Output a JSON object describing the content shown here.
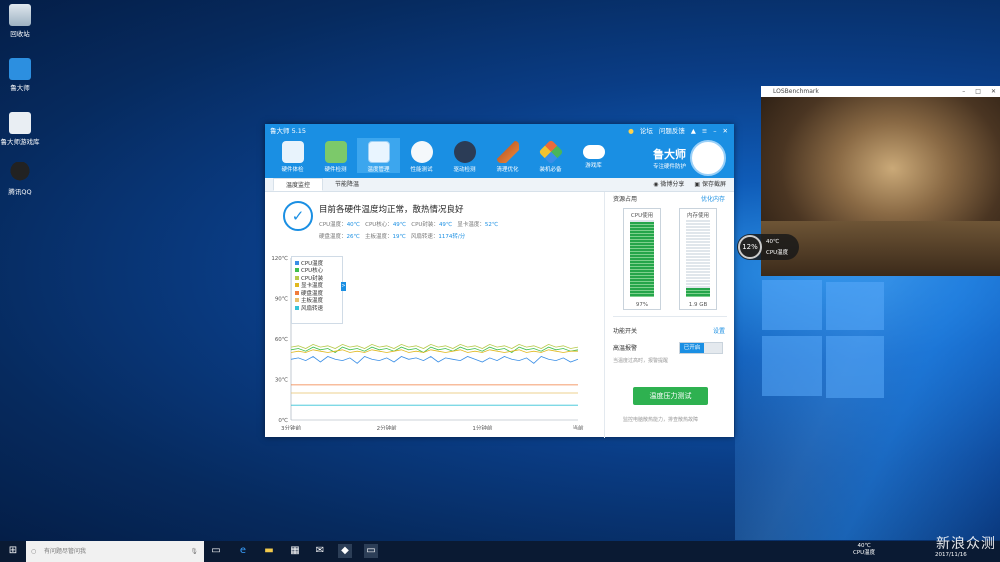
{
  "desktop_icons": [
    {
      "label": "回收站"
    },
    {
      "label": "鲁大师"
    },
    {
      "label": "鲁大师游戏库"
    },
    {
      "label": "腾讯QQ"
    }
  ],
  "app": {
    "title": "鲁大师 5.15",
    "title_links": [
      "论坛",
      "问题反馈"
    ],
    "toolbar": [
      {
        "label": "硬件体检",
        "icon": "monitor-check-icon"
      },
      {
        "label": "硬件检测",
        "icon": "chip-icon"
      },
      {
        "label": "温度管理",
        "icon": "thermometer-icon"
      },
      {
        "label": "性能测试",
        "icon": "speedometer-icon"
      },
      {
        "label": "驱动检测",
        "icon": "driver-icon"
      },
      {
        "label": "清理优化",
        "icon": "broom-icon"
      },
      {
        "label": "装机必备",
        "icon": "box-icon"
      },
      {
        "label": "游戏库",
        "icon": "gamepad-icon"
      }
    ],
    "brand_name": "鲁大师",
    "brand_slogan": "专注硬件防护",
    "tabs": [
      "温度监控",
      "节能降温"
    ],
    "tab_actions": [
      "微博分享",
      "保存截屏"
    ],
    "status_title": "目前各硬件温度均正常，散热情况良好",
    "status_line1": [
      {
        "k": "CPU温度：",
        "v": "40℃"
      },
      {
        "k": "CPU核心：",
        "v": "49℃"
      },
      {
        "k": "CPU封装：",
        "v": "49℃"
      },
      {
        "k": "显卡温度：",
        "v": "52℃"
      }
    ],
    "status_line2": [
      {
        "k": "硬盘温度：",
        "v": "26℃"
      },
      {
        "k": "主板温度：",
        "v": "19℃"
      },
      {
        "k": "风扇转速：",
        "v": "1174转/分"
      }
    ],
    "legend_toggle": ">",
    "sidebar": {
      "title": "资源占用",
      "optimize_link": "优化内存",
      "cpu_label": "CPU使用",
      "cpu_value": "97%",
      "cpu_fill": 0.97,
      "mem_label": "内存使用",
      "mem_value": "1.9 GB",
      "mem_fill": 0.12,
      "switch_title": "功能开关",
      "settings_link": "设置",
      "alarm_label": "高温报警",
      "alarm_state": "已开启",
      "alarm_desc": "当温度过高时，报警提醒",
      "stress_button": "温度压力测试",
      "stress_desc": "监控电脑散热能力，排查散热故障"
    }
  },
  "chart_data": {
    "type": "line",
    "title": "",
    "x": [
      "3分钟前",
      "2分钟前",
      "1分钟前",
      "当前"
    ],
    "yticks": [
      "0℃",
      "30℃",
      "60℃",
      "90℃",
      "120℃"
    ],
    "ylim": [
      0,
      120
    ],
    "grid": false,
    "legend_position": "top-left",
    "series": [
      {
        "name": "CPU温度",
        "color": "#3a8ee6",
        "values": [
          45,
          46,
          44,
          47,
          43,
          47,
          45,
          44,
          46,
          42,
          47,
          45,
          44,
          46,
          43,
          47,
          45,
          46,
          44,
          47,
          43,
          46,
          45,
          44,
          47,
          45,
          43,
          46,
          44,
          47,
          45,
          44,
          46,
          42,
          47,
          45,
          44,
          46,
          43,
          45
        ]
      },
      {
        "name": "CPU核心",
        "color": "#3fbf4f",
        "values": [
          52,
          53,
          51,
          54,
          52,
          53,
          50,
          54,
          52,
          53,
          51,
          54,
          52,
          53,
          51,
          54,
          52,
          53,
          50,
          54,
          52,
          53,
          51,
          54,
          52,
          53,
          51,
          54,
          52,
          53,
          50,
          54,
          52,
          53,
          51,
          54,
          52,
          53,
          51,
          52
        ]
      },
      {
        "name": "CPU封装",
        "color": "#b7c94a",
        "values": [
          54,
          55,
          53,
          56,
          54,
          55,
          53,
          56,
          54,
          55,
          53,
          56,
          54,
          55,
          53,
          56,
          54,
          55,
          53,
          56,
          54,
          55,
          53,
          56,
          54,
          55,
          53,
          56,
          54,
          55,
          53,
          56,
          54,
          55,
          53,
          56,
          54,
          55,
          53,
          54
        ]
      },
      {
        "name": "显卡温度",
        "color": "#e0b81f",
        "values": [
          50,
          51,
          50,
          52,
          51,
          50,
          51,
          52,
          50,
          51,
          50,
          52,
          51,
          50,
          51,
          52,
          50,
          51,
          50,
          52,
          51,
          50,
          51,
          52,
          50,
          51,
          50,
          52,
          51,
          50,
          51,
          52,
          50,
          51,
          50,
          52,
          51,
          50,
          51,
          51
        ]
      },
      {
        "name": "硬盘温度",
        "color": "#f07b3b",
        "values": [
          26,
          26,
          26,
          26,
          26,
          26,
          26,
          26,
          26,
          26,
          26,
          26,
          26,
          26,
          26,
          26,
          26,
          26,
          26,
          26,
          26,
          26,
          26,
          26,
          26,
          26,
          26,
          26,
          26,
          26,
          26,
          26,
          26,
          26,
          26,
          26,
          26,
          26,
          26,
          26
        ]
      },
      {
        "name": "主板温度",
        "color": "#e8c06a",
        "values": [
          20,
          20,
          20,
          20,
          20,
          20,
          20,
          20,
          20,
          20,
          20,
          20,
          20,
          20,
          20,
          20,
          20,
          20,
          20,
          20,
          20,
          20,
          20,
          20,
          20,
          20,
          20,
          20,
          20,
          20,
          20,
          20,
          20,
          20,
          20,
          20,
          20,
          20,
          20,
          20
        ]
      },
      {
        "name": "风扇转速",
        "color": "#35c2d6",
        "values": [
          11,
          11,
          11,
          11,
          11,
          11,
          11,
          11,
          11,
          11,
          11,
          11,
          11,
          11,
          11,
          11,
          11,
          11,
          11,
          11,
          11,
          11,
          11,
          11,
          11,
          11,
          11,
          11,
          11,
          11,
          11,
          11,
          11,
          11,
          11,
          11,
          11,
          11,
          11,
          11
        ]
      }
    ]
  },
  "bench": {
    "title": "LOSBenchmark"
  },
  "overlay": {
    "percent": "12%",
    "temp": "40℃",
    "label": "CPU温度"
  },
  "taskbar": {
    "search_placeholder": "有问题尽管问我",
    "tray_temp": "40℃",
    "tray_label": "CPU温度",
    "date": "2017/11/16"
  },
  "watermark": "新浪众测"
}
